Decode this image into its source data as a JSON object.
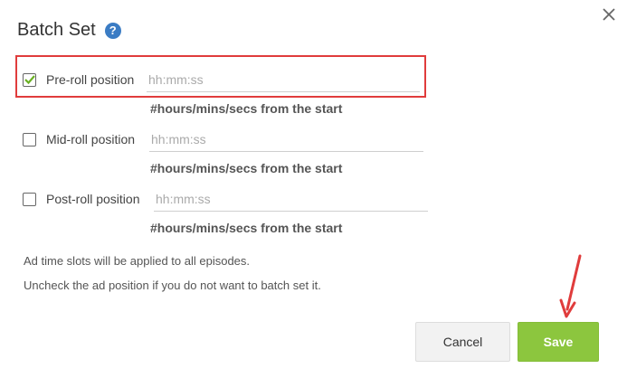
{
  "dialog": {
    "title": "Batch Set",
    "help_icon": "question-circle-icon",
    "help_glyph": "?",
    "close_icon": "close-icon"
  },
  "positions": [
    {
      "label": "Pre-roll position",
      "checked": true,
      "placeholder": "hh:mm:ss",
      "value": "",
      "hint": "#hours/mins/secs from the start"
    },
    {
      "label": "Mid-roll position",
      "checked": false,
      "placeholder": "hh:mm:ss",
      "value": "",
      "hint": "#hours/mins/secs from the start"
    },
    {
      "label": "Post-roll position",
      "checked": false,
      "placeholder": "hh:mm:ss",
      "value": "",
      "hint": "#hours/mins/secs from the start"
    }
  ],
  "notes": [
    "Ad time slots will be applied to all episodes.",
    "Uncheck the ad position if you do not want to batch set it."
  ],
  "buttons": {
    "cancel": "Cancel",
    "save": "Save"
  },
  "colors": {
    "accent_green": "#8cc63e",
    "highlight_red": "#e03c3c",
    "help_blue": "#3b7cc4"
  }
}
